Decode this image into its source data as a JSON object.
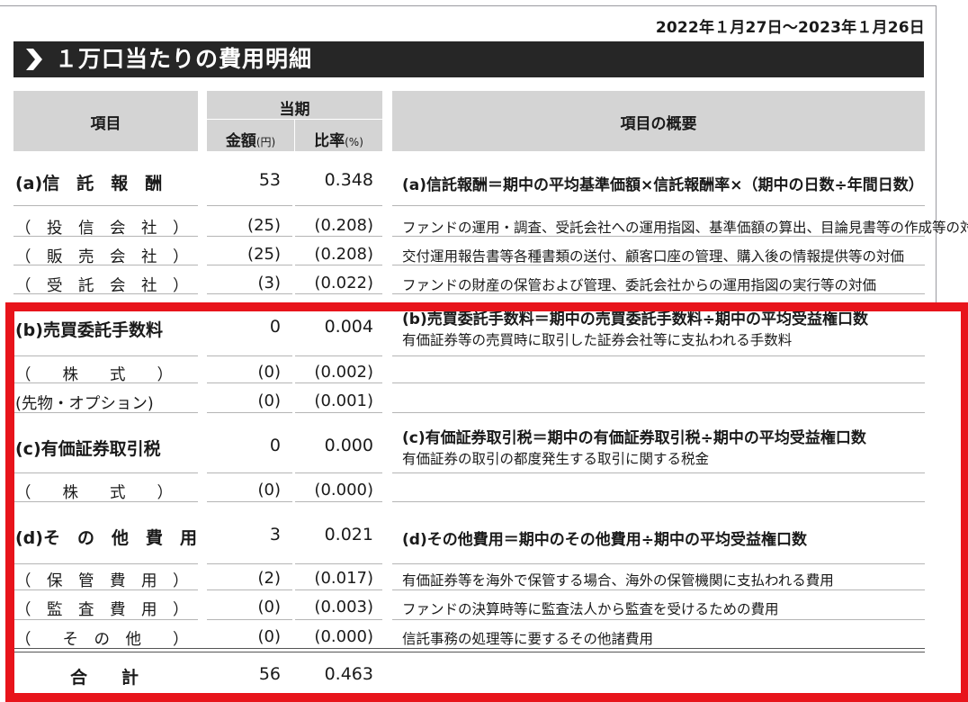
{
  "period": "2022年１月27日～2023年１月26日",
  "title": "１万口当たりの費用明細",
  "header": {
    "item": "項目",
    "current_period": "当期",
    "amount": "金額",
    "amount_unit": "(円)",
    "ratio": "比率",
    "ratio_unit": "(%)",
    "overview": "項目の概要"
  },
  "rows": [
    {
      "label": "(a)信　託　報　酬",
      "amount": "53",
      "ratio": "0.348",
      "desc1": "(a)信託報酬＝期中の平均基準価額×信託報酬率×（期中の日数÷年間日数）",
      "desc2": ""
    },
    {
      "label": "（　投　信　会　社　）",
      "amount": "(25)",
      "ratio": "(0.208)",
      "desc1": "ファンドの運用・調査、受託会社への運用指図、基準価額の算出、目論見書等の作成等の対価",
      "desc2": ""
    },
    {
      "label": "（　販　売　会　社　）",
      "amount": "(25)",
      "ratio": "(0.208)",
      "desc1": "交付運用報告書等各種書類の送付、顧客口座の管理、購入後の情報提供等の対価",
      "desc2": ""
    },
    {
      "label": "（　受　託　会　社　）",
      "amount": "(3)",
      "ratio": "(0.022)",
      "desc1": "ファンドの財産の保管および管理、委託会社からの運用指図の実行等の対価",
      "desc2": ""
    },
    {
      "label": "(b)売買委託手数料",
      "amount": "0",
      "ratio": "0.004",
      "desc1": "(b)売買委託手数料＝期中の売買委託手数料÷期中の平均受益権口数",
      "desc2": "有価証券等の売買時に取引した証券会社等に支払われる手数料"
    },
    {
      "label": "（　　株　　式　　）",
      "amount": "(0)",
      "ratio": "(0.002)",
      "desc1": "",
      "desc2": ""
    },
    {
      "label": "(先物・オプション)",
      "amount": "(0)",
      "ratio": "(0.001)",
      "desc1": "",
      "desc2": ""
    },
    {
      "label": "(c)有価証券取引税",
      "amount": "0",
      "ratio": "0.000",
      "desc1": "(c)有価証券取引税＝期中の有価証券取引税÷期中の平均受益権口数",
      "desc2": "有価証券の取引の都度発生する取引に関する税金"
    },
    {
      "label": "（　　株　　式　　）",
      "amount": "(0)",
      "ratio": "(0.000)",
      "desc1": "",
      "desc2": ""
    },
    {
      "label": "(d)そ　の　他　費　用",
      "amount": "3",
      "ratio": "0.021",
      "desc1": "(d)その他費用＝期中のその他費用÷期中の平均受益権口数",
      "desc2": ""
    },
    {
      "label": "（　保　管　費　用　）",
      "amount": "(2)",
      "ratio": "(0.017)",
      "desc1": "有価証券等を海外で保管する場合、海外の保管機関に支払われる費用",
      "desc2": ""
    },
    {
      "label": "（　監　査　費　用　）",
      "amount": "(0)",
      "ratio": "(0.003)",
      "desc1": "ファンドの決算時等に監査法人から監査を受けるための費用",
      "desc2": ""
    },
    {
      "label": "（　　そ　の　他　　）",
      "amount": "(0)",
      "ratio": "(0.000)",
      "desc1": "信託事務の処理等に要するその他諸費用",
      "desc2": ""
    }
  ],
  "total": {
    "label": "合　　計",
    "amount": "56",
    "ratio": "0.463"
  },
  "colors": {
    "highlight": "#e8141b",
    "banner": "#262626",
    "header_bg": "#d4d4d4"
  }
}
